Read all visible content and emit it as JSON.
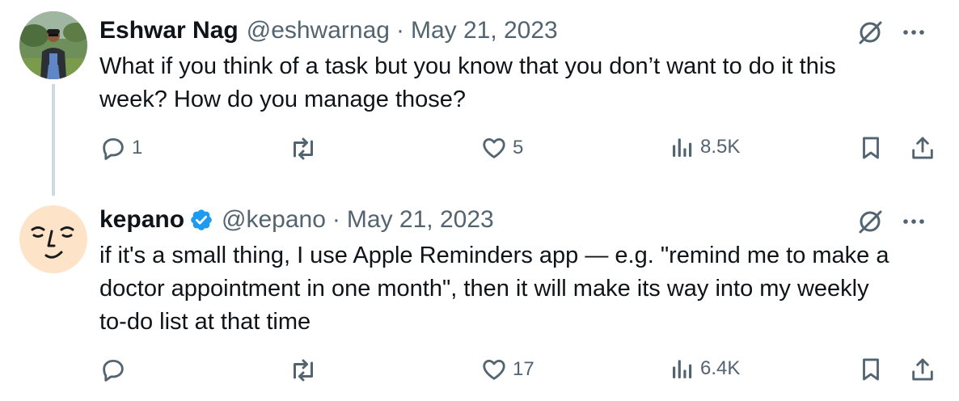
{
  "tweets": [
    {
      "author_name": "Eshwar Nag",
      "handle": "@eshwarnag",
      "separator": "·",
      "date": "May 21, 2023",
      "text_line1": "What if you think of a task but you know that you don’t want to do it this",
      "text_line2": "week? How do you manage those?",
      "replies": "1",
      "retweets": "",
      "likes": "5",
      "views": "8.5K",
      "verified": false
    },
    {
      "author_name": "kepano",
      "handle": "@kepano",
      "separator": "·",
      "date": "May 21, 2023",
      "text_line1": "if it's a small thing, I use Apple Reminders app — e.g. \"remind me to make a",
      "text_line2": "doctor appointment in one month\", then it will make its way into my weekly",
      "text_line3": "to-do list at that time",
      "replies": "",
      "retweets": "",
      "likes": "17",
      "views": "6.4K",
      "verified": true
    }
  ],
  "colors": {
    "text_primary": "#0f1419",
    "text_secondary": "#536471",
    "verified_blue": "#1d9bf0",
    "thread_line": "#cfd9de",
    "kepano_avatar_bg": "#fde4c8"
  },
  "icons": [
    "grok-icon",
    "more-icon",
    "reply-icon",
    "retweet-icon",
    "like-icon",
    "views-icon",
    "bookmark-icon",
    "share-icon",
    "verified-badge-icon"
  ]
}
